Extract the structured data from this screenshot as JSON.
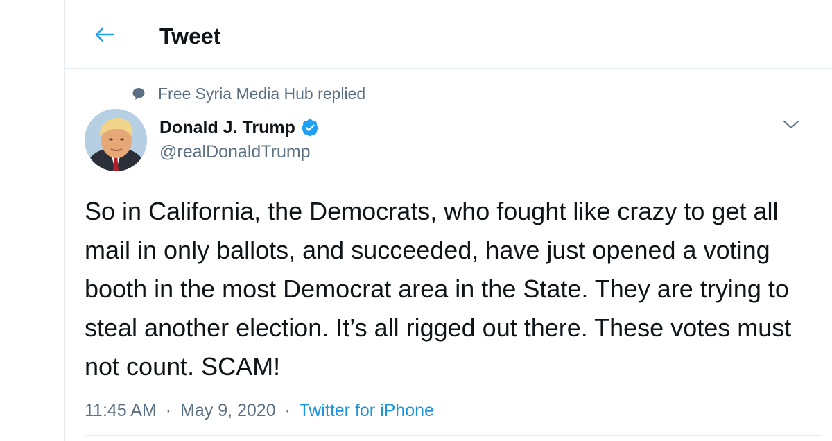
{
  "header": {
    "title": "Tweet",
    "back_icon": "arrow-left-icon"
  },
  "reply_context": {
    "text": "Free Syria Media Hub replied",
    "icon": "speech-bubble-icon"
  },
  "author": {
    "name": "Donald J. Trump",
    "handle": "@realDonaldTrump",
    "verified": true,
    "verified_icon": "verified-badge-icon"
  },
  "tweet": {
    "text": "So in California, the Democrats, who fought like crazy to get all mail in only ballots, and succeeded, have just opened a voting booth in the most Democrat area in the State. They are trying to steal another election. It’s all rigged out there. These votes must not count. SCAM!",
    "time": "11:45 AM",
    "separator": "·",
    "date": "May 9, 2020",
    "source": "Twitter for iPhone"
  },
  "colors": {
    "accent": "#1da1f2",
    "link": "#1b95e0",
    "secondary_text": "#5b7083",
    "divider": "#e6ecf0"
  }
}
